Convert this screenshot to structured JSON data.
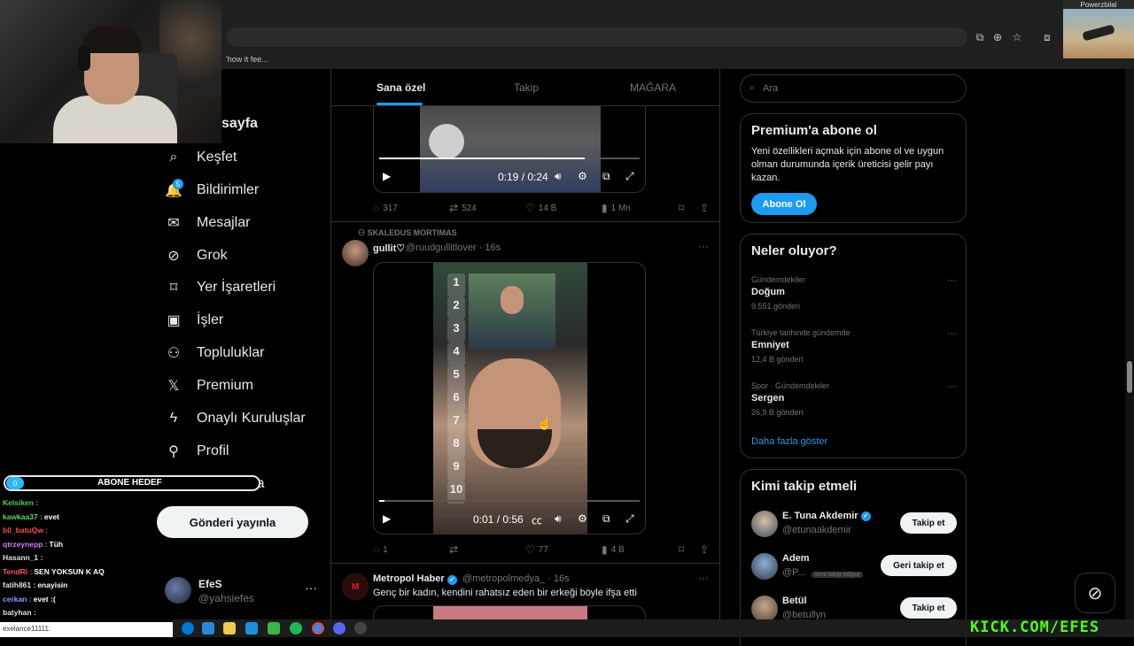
{
  "browser": {
    "bookmark_text": "'how it fee..."
  },
  "webcam": {
    "streamer_pip_name": "Powerzbilal"
  },
  "nav": {
    "home_label": "sayfa",
    "items": [
      {
        "label": "Keşfet",
        "icon": "search-icon",
        "glyph": "⌕"
      },
      {
        "label": "Bildirimler",
        "icon": "bell-icon",
        "glyph": "🔔"
      },
      {
        "label": "Mesajlar",
        "icon": "mail-icon",
        "glyph": "✉"
      },
      {
        "label": "Grok",
        "icon": "grok-icon",
        "glyph": "⊘"
      },
      {
        "label": "Yer İşaretleri",
        "icon": "bookmark-icon",
        "glyph": "⌑"
      },
      {
        "label": "İşler",
        "icon": "briefcase-icon",
        "glyph": "▣"
      },
      {
        "label": "Topluluklar",
        "icon": "communities-icon",
        "glyph": "⚇"
      },
      {
        "label": "Premium",
        "icon": "x-logo-icon",
        "glyph": "𝕏"
      },
      {
        "label": "Onaylı Kuruluşlar",
        "icon": "lightning-icon",
        "glyph": "ϟ"
      },
      {
        "label": "Profil",
        "icon": "user-icon",
        "glyph": "⚲"
      },
      {
        "label": "Daha fazla",
        "icon": "more-circle-icon",
        "glyph": "⋯"
      }
    ],
    "notification_count": "5",
    "post_button": "Gönderi yayınla",
    "account": {
      "name": "EfeS",
      "handle": "@yahsiefes",
      "more": "···"
    }
  },
  "stream_overlay": {
    "sub_goal_count": "0",
    "sub_goal_label": "ABONE HEDEF",
    "chat": [
      {
        "user": "Kelsiken :",
        "msg": "",
        "color": "#4fd14f"
      },
      {
        "user": "kawkaa37 :",
        "msg": "evet",
        "color": "#5ed65e"
      },
      {
        "user": "b0_batuQw :",
        "msg": "",
        "color": "#ff4d4d"
      },
      {
        "user": "qtrzeynepp :",
        "msg": "Tüh",
        "color": "#d07bff"
      },
      {
        "user": "Hasann_1 :",
        "msg": "",
        "color": "#e0e0e0"
      },
      {
        "user": "TendRi :",
        "msg": "SEN YOKSUN K AQ",
        "color": "#ff5a5a"
      },
      {
        "user": "fatih861 :",
        "msg": "enayisin",
        "color": "#e0e0e0"
      },
      {
        "user": "cerkan :",
        "msg": "evet :(",
        "color": "#7aa6ff"
      },
      {
        "user": "batyhan :",
        "msg": "",
        "color": "#e0e0e0"
      }
    ],
    "chat_input": "exelance11111:"
  },
  "feed": {
    "tabs": [
      "Sana özel",
      "Takip",
      "MAĞARA"
    ],
    "active_tab": "Sana özel",
    "post1": {
      "video_time": "0:19 / 0:24",
      "progress": 0.79,
      "replies": "317",
      "reposts": "524",
      "likes": "14 B",
      "views": "1 Mn"
    },
    "post2": {
      "repost_context": "SKALEDUS MORTIMAS",
      "author": "gullit♡",
      "handle": "@ruudgullitlover · 16s",
      "video_time": "0:01 / 0:56",
      "progress": 0.02,
      "numbers": [
        "1",
        "2",
        "3",
        "4",
        "5",
        "6",
        "7",
        "8",
        "9",
        "10"
      ],
      "replies": "1",
      "reposts": "",
      "likes": "77",
      "views": "4 B"
    },
    "post3": {
      "author": "Metropol Haber",
      "handle": "@metropolmedya_ · 16s",
      "text": "Genç bir kadın, kendini rahatsız eden bir erkeği böyle ifşa etti"
    }
  },
  "sidebar": {
    "search_placeholder": "Ara",
    "premium": {
      "title": "Premium'a abone ol",
      "desc": "Yeni özellikleri açmak için abone ol ve uygun olman durumunda içerik üreticisi gelir payı kazan.",
      "button": "Abone Ol"
    },
    "trends": {
      "title": "Neler oluyor?",
      "items": [
        {
          "context": "Gündemdekiler",
          "title": "Doğum",
          "count": "9.551 gönderi"
        },
        {
          "context": "Türkiye tarihinde gündemde",
          "title": "Emniyet",
          "count": "12,4 B gönderi"
        },
        {
          "context": "Spor · Gündemdekiler",
          "title": "Sergen",
          "count": "26,9 B gönderi"
        }
      ],
      "show_more": "Daha fazla göster"
    },
    "who_to_follow": {
      "title": "Kimi takip etmeli",
      "items": [
        {
          "name": "E. Tuna Akdemir",
          "handle": "@etunaakdemir",
          "button": "Takip et",
          "verified": true,
          "follows_you": ""
        },
        {
          "name": "Adem",
          "handle": "@P...",
          "button": "Geri takip et",
          "verified": false,
          "follows_you": "Seni takip ediyor"
        },
        {
          "name": "Betül",
          "handle": "@betullyn",
          "button": "Takip et",
          "verified": false,
          "follows_you": ""
        }
      ]
    }
  },
  "overlay_brand": "KICK.COM/EFES"
}
